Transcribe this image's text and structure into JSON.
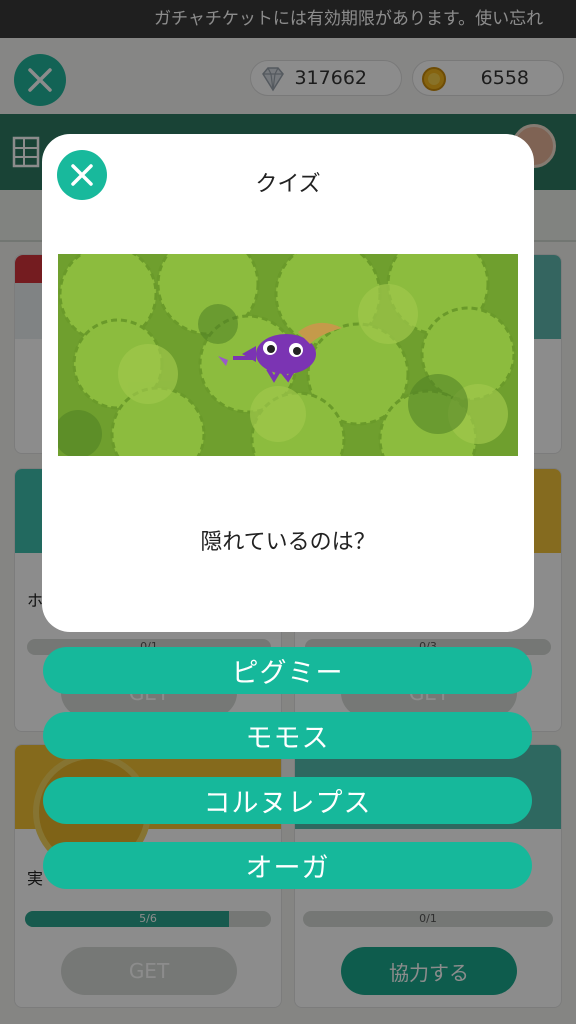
{
  "ticker": {
    "text": "ガチャチケットには有効期限があります。使い忘れ"
  },
  "header": {
    "diamonds": "317662",
    "coins": "6558"
  },
  "cards": {
    "card_left_bottom": {
      "title_prefix": "実",
      "progress": "5/6",
      "progress_ratio": 0.83,
      "button": "GET"
    },
    "card_right_bottom": {
      "progress": "0/1",
      "progress_ratio": 0,
      "button": "協力する"
    },
    "card_left_mid": {
      "title_prefix": "ホ",
      "progress": "0/1",
      "button": "GET"
    },
    "card_right_mid": {
      "progress": "0/3",
      "button": "GET"
    }
  },
  "quiz": {
    "title": "クイズ",
    "question": "隠れているのは？",
    "answers": [
      "ピグミー",
      "モモス",
      "コルヌレプス",
      "オーガ"
    ]
  },
  "colors": {
    "accent": "#16b89b",
    "header_green": "#2f7a63"
  }
}
